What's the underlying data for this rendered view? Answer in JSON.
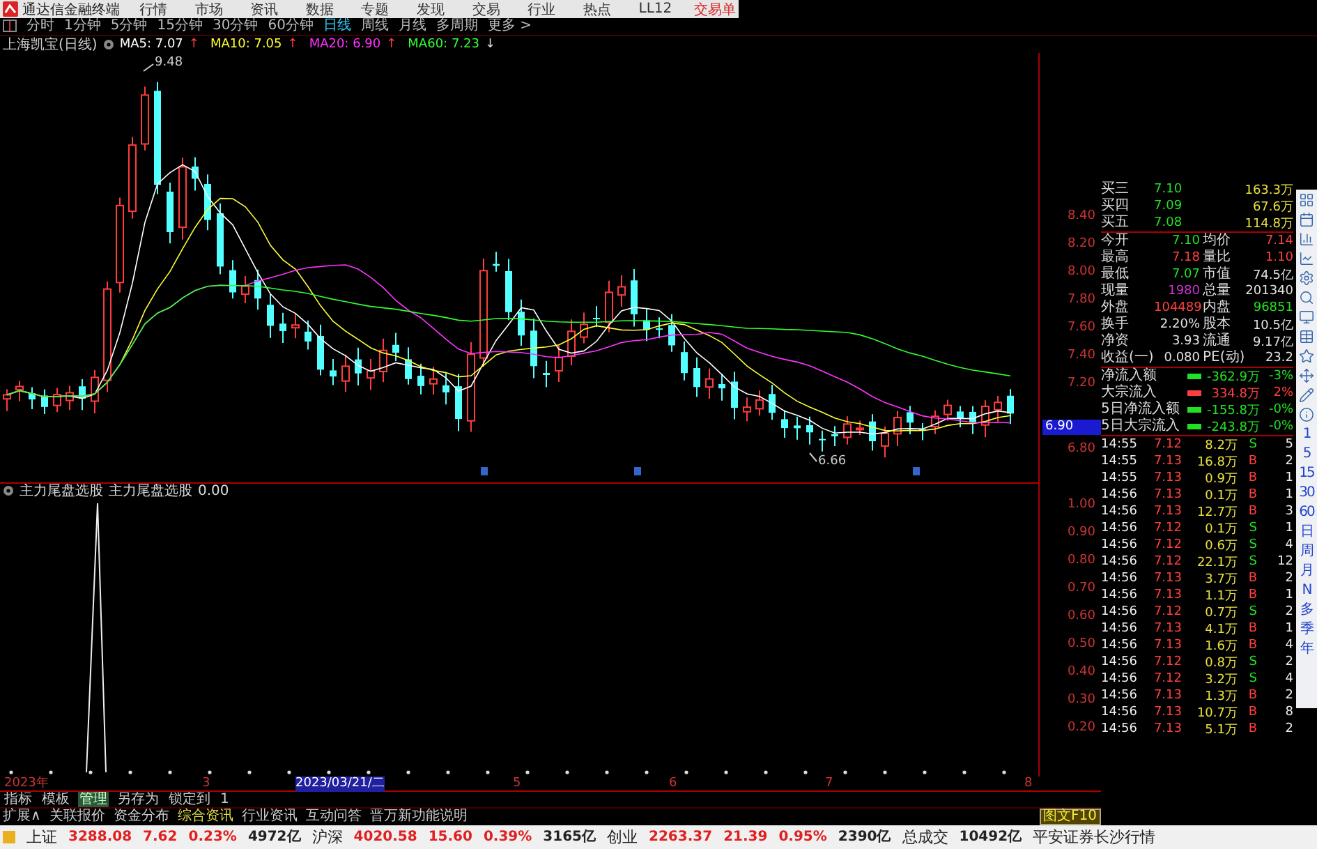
{
  "menu": {
    "app_title": "通达信金融终端",
    "items": [
      "行情",
      "市场",
      "资讯",
      "数据",
      "专题",
      "发现",
      "交易",
      "行业",
      "热点",
      "LL12"
    ],
    "trade_link": "交易单"
  },
  "periods": [
    {
      "label": "分时",
      "selected": false
    },
    {
      "label": "1分钟",
      "selected": false
    },
    {
      "label": "5分钟",
      "selected": false
    },
    {
      "label": "15分钟",
      "selected": false
    },
    {
      "label": "30分钟",
      "selected": false
    },
    {
      "label": "60分钟",
      "selected": false
    },
    {
      "label": "日线",
      "selected": true
    },
    {
      "label": "周线",
      "selected": false
    },
    {
      "label": "月线",
      "selected": false
    },
    {
      "label": "多周期",
      "selected": false
    },
    {
      "label": "更多 >",
      "selected": false
    }
  ],
  "ma_row": {
    "title": "上海凯宝(日线)",
    "lines": [
      {
        "label": "MA5: 7.07",
        "arrow": "↑",
        "color": "#ffffff",
        "rising": true
      },
      {
        "label": "MA10: 7.05",
        "arrow": "↑",
        "color": "#ffff33",
        "rising": true
      },
      {
        "label": "MA20: 6.90",
        "arrow": "↑",
        "color": "#ff33ff",
        "rising": true
      },
      {
        "label": "MA60: 7.23",
        "arrow": "↓",
        "color": "#33ff33",
        "rising": false
      }
    ]
  },
  "main_chart": {
    "high_label": "9.48",
    "low_label": "6.66",
    "price_axis": [
      "8.40",
      "8.20",
      "8.00",
      "7.80",
      "7.60",
      "7.40",
      "7.20"
    ],
    "cursor_price": "6.90",
    "price_axis_low": "6.80"
  },
  "indicator": {
    "name": "主力尾盘选股",
    "formula": "主力尾盘选股",
    "value": "0.00",
    "axis": [
      "1.00",
      "0.90",
      "0.80",
      "0.70",
      "0.60",
      "0.50",
      "0.40",
      "0.30",
      "0.20"
    ]
  },
  "date_axis": [
    {
      "label": "2023年",
      "selected": false
    },
    {
      "label": "3",
      "selected": false
    },
    {
      "label": "2023/03/21/二",
      "selected": true
    },
    {
      "label": "5",
      "selected": false
    },
    {
      "label": "6",
      "selected": false
    },
    {
      "label": "7",
      "selected": false
    },
    {
      "label": "8",
      "selected": false
    }
  ],
  "bottom_tabs": [
    {
      "label": "指标",
      "selected": false
    },
    {
      "label": "模板",
      "selected": false
    },
    {
      "label": "管理",
      "selected": true
    },
    {
      "label": "另存为",
      "selected": false
    },
    {
      "label": "锁定到",
      "selected": false
    },
    {
      "label": "1",
      "selected": false
    }
  ],
  "extension_tabs": [
    {
      "label": "扩展∧",
      "selected": false
    },
    {
      "label": "关联报价",
      "selected": false
    },
    {
      "label": "资金分布",
      "selected": false
    },
    {
      "label": "综合资讯",
      "selected": true
    },
    {
      "label": "行业资讯",
      "selected": false
    },
    {
      "label": "互动问答",
      "selected": false
    },
    {
      "label": "晋万新功能说明",
      "selected": false
    }
  ],
  "f10_button": "图文F10",
  "quote": {
    "bids": [
      {
        "label": "买三",
        "price": "7.10",
        "volume": "163.3万"
      },
      {
        "label": "买四",
        "price": "7.09",
        "volume": "67.6万"
      },
      {
        "label": "买五",
        "price": "7.08",
        "volume": "114.8万"
      }
    ],
    "stats": [
      [
        {
          "label": "今开",
          "value": "7.10",
          "color": "#22e022"
        },
        {
          "label": "均价",
          "value": "7.14",
          "color": "#ff4040"
        }
      ],
      [
        {
          "label": "最高",
          "value": "7.18",
          "color": "#ff4040"
        },
        {
          "label": "量比",
          "value": "1.10",
          "color": "#ff4040"
        }
      ],
      [
        {
          "label": "最低",
          "value": "7.07",
          "color": "#22e022"
        },
        {
          "label": "市值",
          "value": "74.5亿",
          "color": "#e0e0e0"
        }
      ],
      [
        {
          "label": "现量",
          "value": "1980",
          "color": "#cc33cc"
        },
        {
          "label": "总量",
          "value": "201340",
          "color": "#e0e0e0"
        }
      ],
      [
        {
          "label": "外盘",
          "value": "104489",
          "color": "#ff4040"
        },
        {
          "label": "内盘",
          "value": "96851",
          "color": "#22e022"
        }
      ],
      [
        {
          "label": "换手",
          "value": "2.20%",
          "color": "#e0e0e0"
        },
        {
          "label": "股本",
          "value": "10.5亿",
          "color": "#e0e0e0"
        }
      ],
      [
        {
          "label": "净资",
          "value": "3.93",
          "color": "#e0e0e0"
        },
        {
          "label": "流通",
          "value": "9.17亿",
          "color": "#e0e0e0"
        }
      ],
      [
        {
          "label": "收益(一)",
          "value": "0.080",
          "color": "#e0e0e0"
        },
        {
          "label": "PE(动)",
          "value": "23.2",
          "color": "#e0e0e0"
        }
      ]
    ],
    "flows": [
      {
        "label": "净流入额",
        "value": "-362.9万",
        "pct": "-3%",
        "color": "#22e022"
      },
      {
        "label": "大宗流入",
        "value": "334.8万",
        "pct": "2%",
        "color": "#ff4040"
      },
      {
        "label": "5日净流入额",
        "value": "-155.8万",
        "pct": "-0%",
        "color": "#22e022"
      },
      {
        "label": "5日大宗流入",
        "value": "-243.8万",
        "pct": "-0%",
        "color": "#22e022"
      }
    ],
    "ticks": [
      {
        "time": "14:55",
        "price": "7.12",
        "volume": "8.2万",
        "side": "S",
        "sell": true,
        "count": "5"
      },
      {
        "time": "14:55",
        "price": "7.13",
        "volume": "16.8万",
        "side": "B",
        "sell": false,
        "count": "2"
      },
      {
        "time": "14:55",
        "price": "7.13",
        "volume": "0.9万",
        "side": "B",
        "sell": false,
        "count": "1"
      },
      {
        "time": "14:56",
        "price": "7.13",
        "volume": "0.1万",
        "side": "B",
        "sell": false,
        "count": "1"
      },
      {
        "time": "14:56",
        "price": "7.13",
        "volume": "12.7万",
        "side": "B",
        "sell": false,
        "count": "3"
      },
      {
        "time": "14:56",
        "price": "7.12",
        "volume": "0.1万",
        "side": "S",
        "sell": true,
        "count": "1"
      },
      {
        "time": "14:56",
        "price": "7.12",
        "volume": "0.6万",
        "side": "S",
        "sell": true,
        "count": "4"
      },
      {
        "time": "14:56",
        "price": "7.12",
        "volume": "22.1万",
        "side": "S",
        "sell": true,
        "count": "12"
      },
      {
        "time": "14:56",
        "price": "7.13",
        "volume": "3.7万",
        "side": "B",
        "sell": false,
        "count": "2"
      },
      {
        "time": "14:56",
        "price": "7.13",
        "volume": "1.1万",
        "side": "B",
        "sell": false,
        "count": "1"
      },
      {
        "time": "14:56",
        "price": "7.12",
        "volume": "0.7万",
        "side": "S",
        "sell": true,
        "count": "2"
      },
      {
        "time": "14:56",
        "price": "7.13",
        "volume": "4.1万",
        "side": "B",
        "sell": false,
        "count": "1"
      },
      {
        "time": "14:56",
        "price": "7.13",
        "volume": "1.6万",
        "side": "B",
        "sell": false,
        "count": "4"
      },
      {
        "time": "14:56",
        "price": "7.12",
        "volume": "0.8万",
        "side": "S",
        "sell": true,
        "count": "2"
      },
      {
        "time": "14:56",
        "price": "7.12",
        "volume": "3.2万",
        "side": "S",
        "sell": true,
        "count": "4"
      },
      {
        "time": "14:56",
        "price": "7.13",
        "volume": "1.3万",
        "side": "B",
        "sell": false,
        "count": "2"
      },
      {
        "time": "14:56",
        "price": "7.13",
        "volume": "10.7万",
        "side": "B",
        "sell": false,
        "count": "8"
      },
      {
        "time": "14:56",
        "price": "7.13",
        "volume": "5.1万",
        "side": "B",
        "sell": false,
        "count": "2"
      }
    ]
  },
  "side_periods": [
    "1",
    "5",
    "15",
    "30",
    "60",
    "日",
    "周",
    "月",
    "N",
    "多",
    "季",
    "年"
  ],
  "status_bar": {
    "indices": [
      {
        "name": "上证",
        "value": "3288.08",
        "change": "7.62",
        "pct": "0.23%",
        "amount": "4972亿"
      },
      {
        "name": "沪深",
        "value": "4020.58",
        "change": "15.60",
        "pct": "0.39%",
        "amount": "3165亿"
      },
      {
        "name": "创业",
        "value": "2263.37",
        "change": "21.39",
        "pct": "0.95%",
        "amount": "2390亿"
      }
    ],
    "total_label": "总成交",
    "total_value": "10492亿",
    "broker": "平安证券长沙行情"
  }
}
